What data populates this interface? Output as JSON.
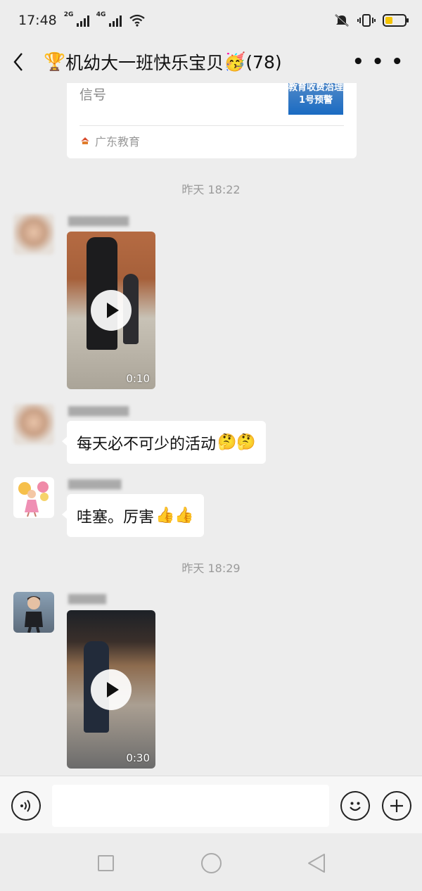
{
  "status_bar": {
    "time": "17:48",
    "network_1": "2G",
    "network_2": "4G",
    "icons": [
      "signal-icon",
      "signal-icon",
      "wifi-icon",
      "mute-icon",
      "vibrate-icon",
      "battery-icon"
    ],
    "battery_level": 0.4,
    "battery_color": "#f5c400"
  },
  "header": {
    "title_prefix": "🏆",
    "title_text": "机幼大一班快乐宝贝",
    "title_suffix": "🥳",
    "member_count": "(78)",
    "back_icon": "chevron-left-icon",
    "more_icon": "more-icon"
  },
  "share_card": {
    "text": "信号",
    "thumb_line1": "教育收费治理",
    "thumb_line2": "1号预警",
    "source": "广东教育"
  },
  "messages": {
    "ts1": "昨天 18:22",
    "video1_duration": "0:10",
    "bubble1_text": "每天必不可少的活动",
    "bubble1_emoji": "🤔🤔",
    "bubble2_text": "哇塞。厉害",
    "bubble2_emoji": "👍👍",
    "ts2": "昨天 18:29",
    "video2_duration": "0:30"
  },
  "input_bar": {
    "voice_icon": "voice-icon",
    "input_value": "",
    "emoji_icon": "smiley-icon",
    "plus_icon": "plus-icon"
  },
  "colors": {
    "background": "#ededed",
    "bubble": "#ffffff",
    "timestamp": "#9a9a9a"
  }
}
